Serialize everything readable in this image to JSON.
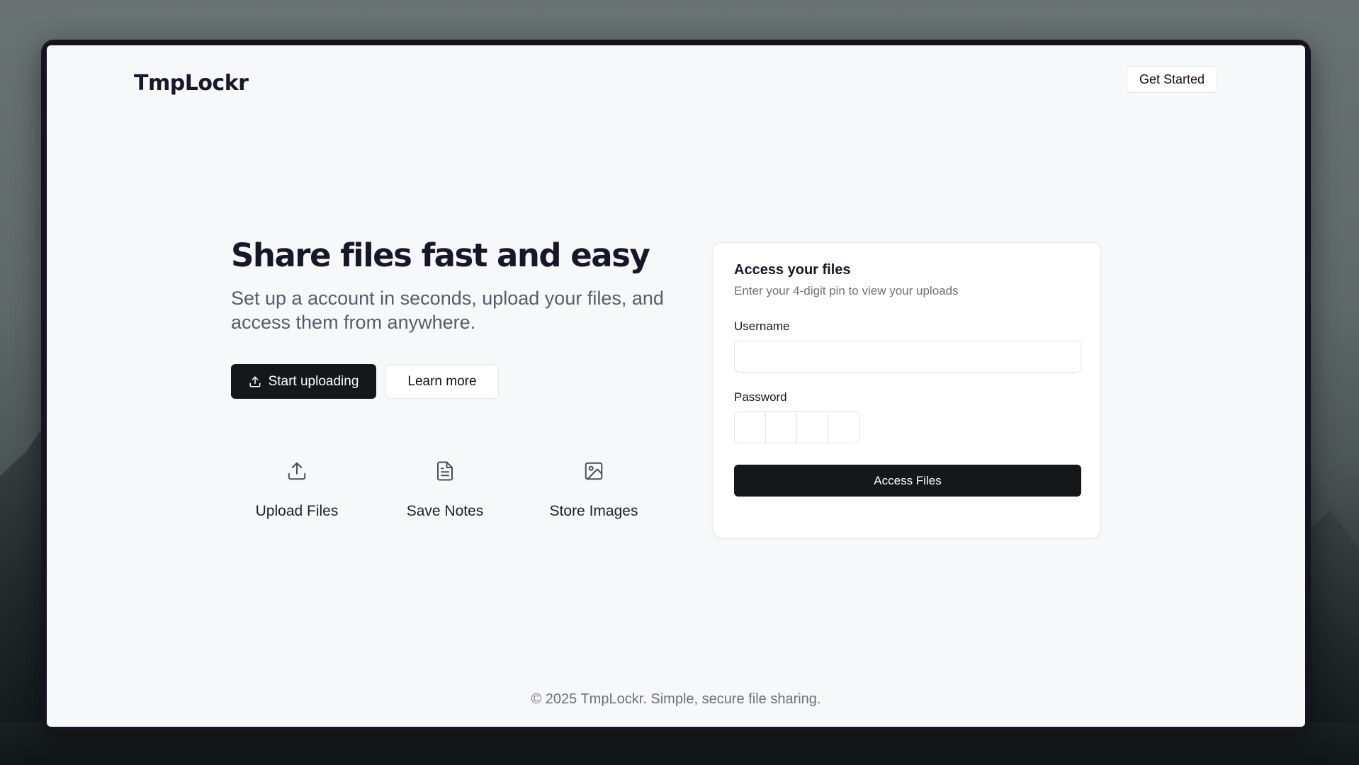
{
  "app": {
    "logo": "TmpLockr",
    "nav_cta": "Get Started"
  },
  "hero": {
    "title": "Share files fast and easy",
    "subtitle": "Set up a account in seconds, upload your files, and access them from anywhere.",
    "primary_button": "Start uploading",
    "primary_button_icon": "upload-icon",
    "secondary_button": "Learn more"
  },
  "features": [
    {
      "label": "Upload Files",
      "icon": "upload-icon"
    },
    {
      "label": "Save Notes",
      "icon": "document-icon"
    },
    {
      "label": "Store Images",
      "icon": "image-icon"
    }
  ],
  "access_card": {
    "title": "Access your files",
    "description": "Enter your 4-digit pin to view your uploads",
    "username_label": "Username",
    "username_value": "",
    "password_label": "Password",
    "pin_values": [
      "",
      "",
      "",
      ""
    ],
    "submit_label": "Access Files"
  },
  "footer": {
    "text": "© 2025 TmpLockr. Simple, secure file sharing."
  },
  "colors": {
    "primary_dark": "#15171b",
    "page_bg": "#f6f8fa",
    "heading": "#161827",
    "muted_text": "#6a7079"
  }
}
